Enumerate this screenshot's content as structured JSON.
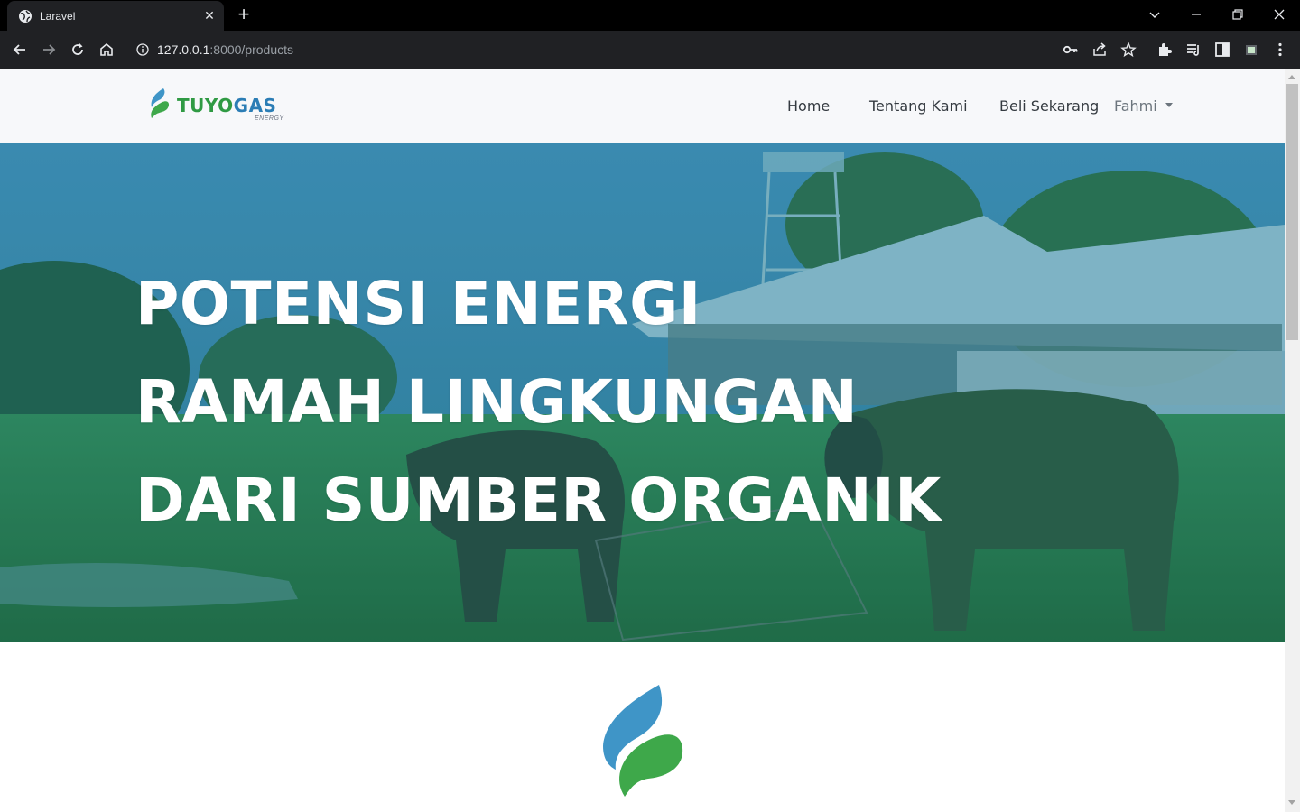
{
  "browser": {
    "tab_title": "Laravel",
    "tab_close": "✕",
    "new_tab": "+",
    "url_host": "127.0.0.1",
    "url_rest": ":8000/products",
    "icons": [
      "globe-icon",
      "back-icon",
      "forward-icon",
      "reload-icon",
      "home-icon",
      "info-icon",
      "key-icon",
      "share-icon",
      "star-icon",
      "extensions-icon",
      "reading-list-icon",
      "sidepanel-icon",
      "profile-icon",
      "menu-icon",
      "chevron-down-icon",
      "minimize-icon",
      "restore-icon",
      "close-icon"
    ]
  },
  "navbar": {
    "brand_tuyo": "TUYO",
    "brand_gas": "GAS",
    "brand_sub": "ENERGY",
    "links": [
      "Home",
      "Tentang Kami",
      "Beli Sekarang"
    ],
    "user": "Fahmi"
  },
  "hero": {
    "lines": [
      "POTENSI ENERGI",
      "RAMAH LINGKUNGAN",
      "DARI SUMBER ORGANIK"
    ]
  },
  "colors": {
    "brand_green": "#2f9a43",
    "brand_blue": "#2b7db5",
    "hero_tint": "#1f6f8a"
  }
}
